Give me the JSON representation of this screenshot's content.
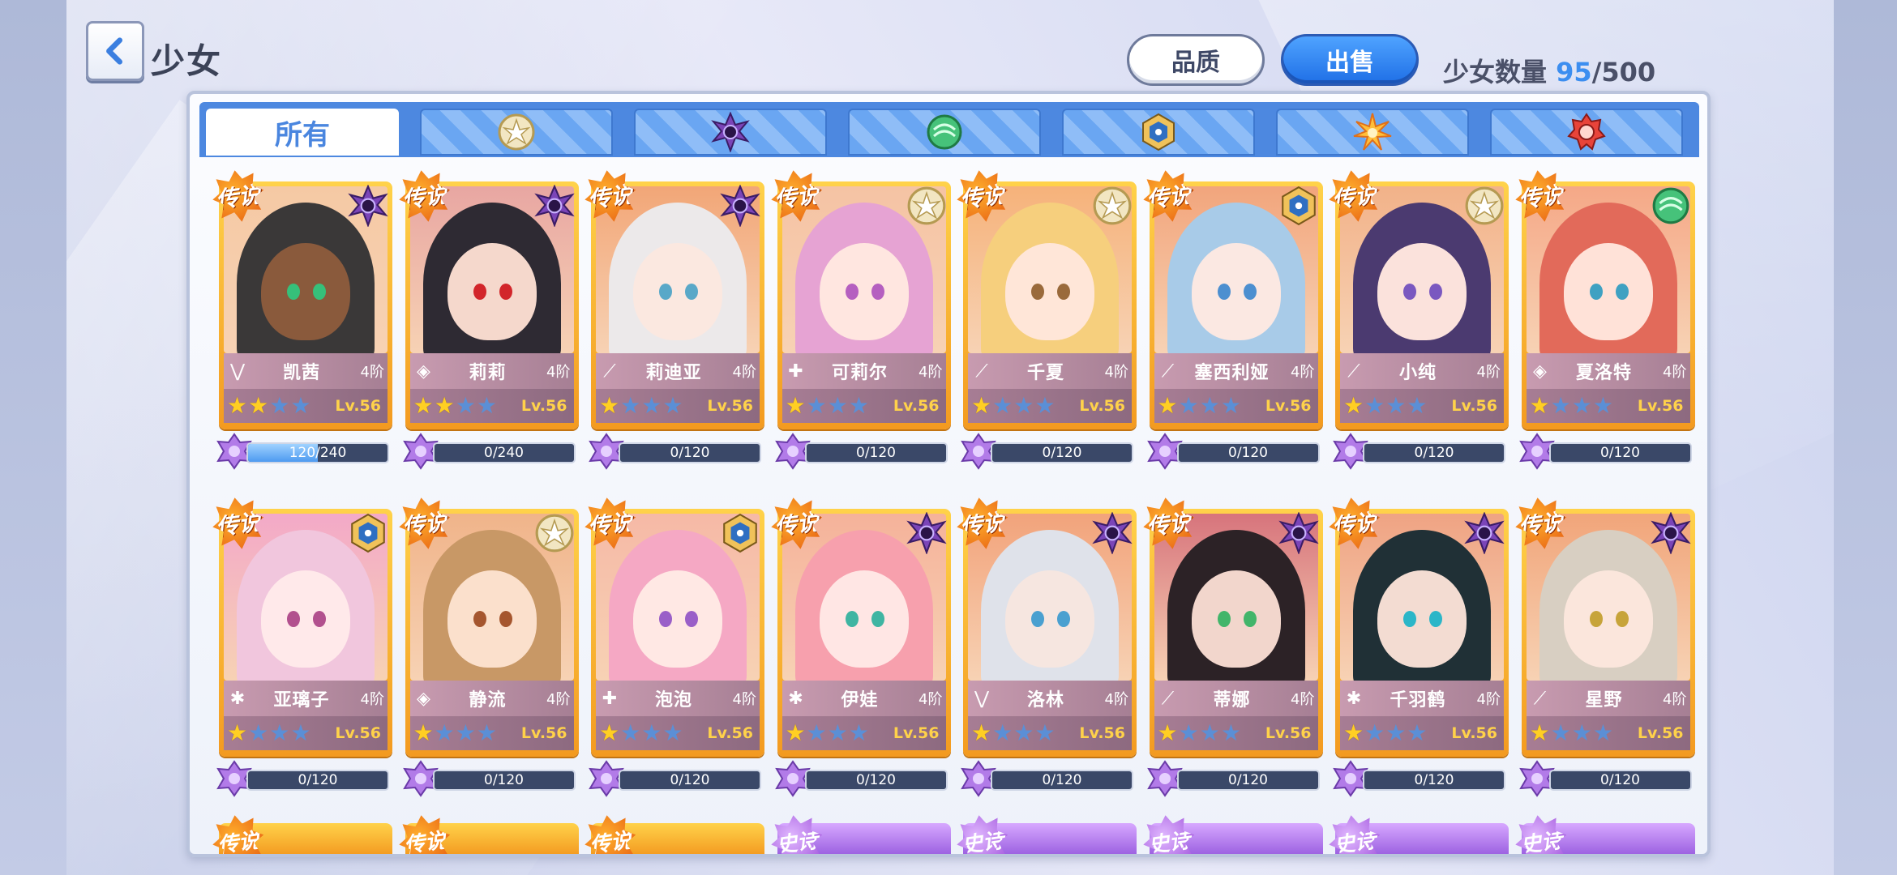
{
  "header": {
    "title": "少女",
    "quality_label": "品质",
    "sell_label": "出售",
    "count_label": "少女数量",
    "count_current": "95",
    "count_sep": "/",
    "count_max": "500"
  },
  "tabs": [
    {
      "label": "所有",
      "icon": "all",
      "active": true
    },
    {
      "label": "",
      "icon": "light-element-icon",
      "color": "#e6c77a"
    },
    {
      "label": "",
      "icon": "dark-element-icon",
      "color": "#6b3fa8"
    },
    {
      "label": "",
      "icon": "wind-element-icon",
      "color": "#38b06a"
    },
    {
      "label": "",
      "icon": "ice-element-icon",
      "color": "#e8b54a"
    },
    {
      "label": "",
      "icon": "fire-sun-element-icon",
      "color": "#f0a030"
    },
    {
      "label": "",
      "icon": "flame-element-icon",
      "color": "#d2352d"
    }
  ],
  "rarity_label": "传说",
  "cards": [
    {
      "name": "凯茜",
      "tier": "4阶",
      "level": "Lv.56",
      "stars": 2,
      "xp": "120/240",
      "xp_ratio": 0.5,
      "element": "dark",
      "class": "assassin",
      "hair": "#3a3838",
      "skin": "#8a5a3c",
      "bg": "#f5c9a4",
      "eye": "#36c07a"
    },
    {
      "name": "莉莉",
      "tier": "4阶",
      "level": "Lv.56",
      "stars": 2,
      "xp": "0/240",
      "xp_ratio": 0,
      "element": "dark",
      "class": "defender",
      "hair": "#2e2a33",
      "skin": "#f5d8cc",
      "bg": "#e8a6a2",
      "eye": "#d2252a"
    },
    {
      "name": "莉迪亚",
      "tier": "4阶",
      "level": "Lv.56",
      "stars": 1,
      "xp": "0/120",
      "xp_ratio": 0,
      "element": "dark",
      "class": "ranger",
      "hair": "#ece9ea",
      "skin": "#fbe8e0",
      "bg": "#f2a677",
      "eye": "#59a8c8"
    },
    {
      "name": "可莉尔",
      "tier": "4阶",
      "level": "Lv.56",
      "stars": 1,
      "xp": "0/120",
      "xp_ratio": 0,
      "element": "light",
      "class": "healer",
      "hair": "#e6a3d3",
      "skin": "#ffe6e0",
      "bg": "#f5c3a4",
      "eye": "#b55fc0"
    },
    {
      "name": "千夏",
      "tier": "4阶",
      "level": "Lv.56",
      "stars": 1,
      "xp": "0/120",
      "xp_ratio": 0,
      "element": "light",
      "class": "ranger",
      "hair": "#f6cf7d",
      "skin": "#ffe6d8",
      "bg": "#f6b27a",
      "eye": "#9a6a3b"
    },
    {
      "name": "塞西利娅",
      "tier": "4阶",
      "level": "Lv.56",
      "stars": 1,
      "xp": "0/120",
      "xp_ratio": 0,
      "element": "ice",
      "class": "ranger",
      "hair": "#a8cbe8",
      "skin": "#fbe8e2",
      "bg": "#f2a57c",
      "eye": "#4c8fd0"
    },
    {
      "name": "小纯",
      "tier": "4阶",
      "level": "Lv.56",
      "stars": 1,
      "xp": "0/120",
      "xp_ratio": 0,
      "element": "light",
      "class": "ranger",
      "hair": "#4b3a70",
      "skin": "#fbe2dc",
      "bg": "#f2b289",
      "eye": "#7a58c0"
    },
    {
      "name": "夏洛特",
      "tier": "4阶",
      "level": "Lv.56",
      "stars": 1,
      "xp": "0/120",
      "xp_ratio": 0,
      "element": "wind",
      "class": "defender",
      "hair": "#e26a5a",
      "skin": "#ffe2d8",
      "bg": "#f5a887",
      "eye": "#3fa1c2"
    },
    {
      "name": "亚璃子",
      "tier": "4阶",
      "level": "Lv.56",
      "stars": 1,
      "xp": "0/120",
      "xp_ratio": 0,
      "element": "ice",
      "class": "mage",
      "hair": "#f1c6dd",
      "skin": "#ffe9ea",
      "bg": "#f3a9c8",
      "eye": "#b2508e"
    },
    {
      "name": "静流",
      "tier": "4阶",
      "level": "Lv.56",
      "stars": 1,
      "xp": "0/120",
      "xp_ratio": 0,
      "element": "light",
      "class": "defender",
      "hair": "#c89866",
      "skin": "#fbe0cc",
      "bg": "#f0b48a",
      "eye": "#a5562e"
    },
    {
      "name": "泡泡",
      "tier": "4阶",
      "level": "Lv.56",
      "stars": 1,
      "xp": "0/120",
      "xp_ratio": 0,
      "element": "ice",
      "class": "healer",
      "hair": "#f5a8c4",
      "skin": "#ffe8e4",
      "bg": "#f6b9a6",
      "eye": "#9a5fc8"
    },
    {
      "name": "伊娃",
      "tier": "4阶",
      "level": "Lv.56",
      "stars": 1,
      "xp": "0/120",
      "xp_ratio": 0,
      "element": "dark",
      "class": "mage",
      "hair": "#f7a0ad",
      "skin": "#ffe6e4",
      "bg": "#f5b29a",
      "eye": "#3fb5a2"
    },
    {
      "name": "洛林",
      "tier": "4阶",
      "level": "Lv.56",
      "stars": 1,
      "xp": "0/120",
      "xp_ratio": 0,
      "element": "dark",
      "class": "assassin",
      "hair": "#dfe2ea",
      "skin": "#f6e6e0",
      "bg": "#f2a37b",
      "eye": "#4aa0d0"
    },
    {
      "name": "蒂娜",
      "tier": "4阶",
      "level": "Lv.56",
      "stars": 1,
      "xp": "0/120",
      "xp_ratio": 0,
      "element": "dark",
      "class": "ranger",
      "hair": "#2c2226",
      "skin": "#f2d6cc",
      "bg": "#d7747c",
      "eye": "#42b56a"
    },
    {
      "name": "千羽鹤",
      "tier": "4阶",
      "level": "Lv.56",
      "stars": 1,
      "xp": "0/120",
      "xp_ratio": 0,
      "element": "dark",
      "class": "mage",
      "hair": "#203036",
      "skin": "#f3dcd2",
      "bg": "#efa383",
      "eye": "#2bb6c8"
    },
    {
      "name": "星野",
      "tier": "4阶",
      "level": "Lv.56",
      "stars": 1,
      "xp": "0/120",
      "xp_ratio": 0,
      "element": "dark",
      "class": "ranger",
      "hair": "#d8cfc2",
      "skin": "#fbe6dc",
      "bg": "#f1a57a",
      "eye": "#c7a43a"
    }
  ],
  "partial_row": [
    "gold",
    "gold",
    "gold",
    "purple",
    "purple",
    "purple",
    "purple",
    "purple"
  ],
  "partial_labels": [
    "传说",
    "传说",
    "传说",
    "史诗",
    "史诗",
    "史诗",
    "史诗",
    "史诗"
  ],
  "colors": {
    "accent_blue": "#3c8ef0",
    "legendary_gold": "#f39a20",
    "epic_purple": "#9a5fe0"
  }
}
